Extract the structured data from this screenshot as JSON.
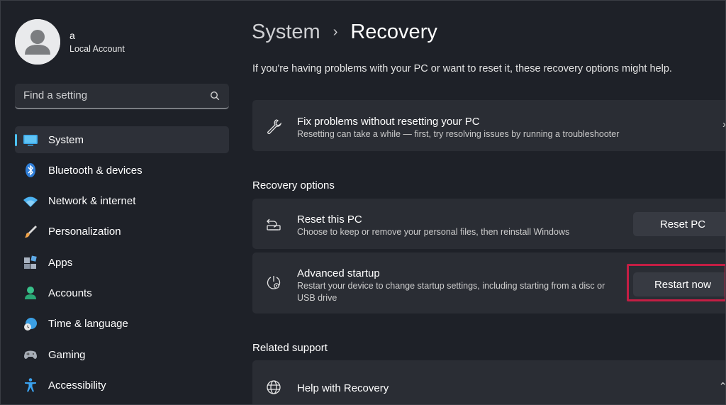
{
  "user": {
    "name": "a",
    "account_type": "Local Account"
  },
  "search": {
    "placeholder": "Find a setting"
  },
  "nav": [
    {
      "label": "System",
      "icon": "system-icon",
      "active": true
    },
    {
      "label": "Bluetooth & devices",
      "icon": "bluetooth-icon"
    },
    {
      "label": "Network & internet",
      "icon": "wifi-icon"
    },
    {
      "label": "Personalization",
      "icon": "brush-icon"
    },
    {
      "label": "Apps",
      "icon": "apps-icon"
    },
    {
      "label": "Accounts",
      "icon": "person-icon"
    },
    {
      "label": "Time & language",
      "icon": "globe-clock-icon"
    },
    {
      "label": "Gaming",
      "icon": "gamepad-icon"
    },
    {
      "label": "Accessibility",
      "icon": "accessibility-icon"
    }
  ],
  "breadcrumb": {
    "parent": "System",
    "separator": "›",
    "current": "Recovery"
  },
  "intro": "If you're having problems with your PC or want to reset it, these recovery options might help.",
  "fix_card": {
    "title": "Fix problems without resetting your PC",
    "description": "Resetting can take a while — first, try resolving issues by running a troubleshooter",
    "icon": "wrench-icon"
  },
  "recovery_options": {
    "heading": "Recovery options",
    "reset": {
      "title": "Reset this PC",
      "description": "Choose to keep or remove your personal files, then reinstall Windows",
      "button": "Reset PC",
      "icon": "reset-pc-icon"
    },
    "advanced": {
      "title": "Advanced startup",
      "description": "Restart your device to change startup settings, including starting from a disc or USB drive",
      "button": "Restart now",
      "icon": "advanced-startup-icon"
    }
  },
  "related_support": {
    "heading": "Related support",
    "help": {
      "title": "Help with Recovery",
      "icon": "globe-icon"
    }
  },
  "colors": {
    "background": "#1e2128",
    "card": "#2a2d34",
    "accent": "#4cc2ff",
    "highlight": "#c41e44"
  }
}
